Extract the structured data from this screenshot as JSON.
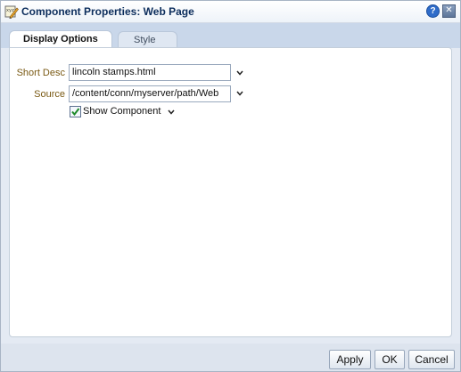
{
  "dialog": {
    "title": "Component Properties: Web Page",
    "help_glyph": "?",
    "close_glyph": "✕"
  },
  "tabs": [
    {
      "label": "Display Options",
      "active": true
    },
    {
      "label": "Style",
      "active": false
    }
  ],
  "form": {
    "short_desc": {
      "label": "Short Desc",
      "value": "lincoln stamps.html"
    },
    "source": {
      "label": "Source",
      "value": "/content/conn/myserver/path/Web"
    },
    "show_component": {
      "label": "Show Component",
      "checked": true
    }
  },
  "footer": {
    "apply_label": "Apply",
    "ok_label": "OK",
    "cancel_label": "Cancel"
  },
  "icons": {
    "title_icon": "edit-properties-icon",
    "dropdown": "chevron-down-icon"
  },
  "colors": {
    "label_color": "#7a5a14",
    "title_color": "#0c2d5c"
  }
}
